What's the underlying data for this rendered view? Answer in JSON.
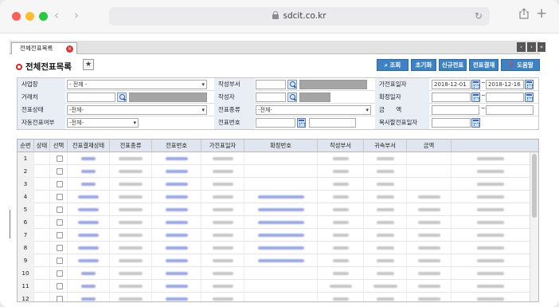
{
  "browser": {
    "url": "sdcit.co.kr"
  },
  "tab": {
    "label": "전체전표목록"
  },
  "page": {
    "title": "전체전표목록"
  },
  "toolbar": {
    "search": "조회",
    "reset": "초기화",
    "new": "신규전표",
    "approve": "전표결재",
    "help": "도움말"
  },
  "form": {
    "row1": {
      "l1": "사업장",
      "v1": "- 전체 -",
      "l2": "작성부서",
      "l3": "가전표일자",
      "date_from": "2018-12-01",
      "date_to": "2018-12-16"
    },
    "row2": {
      "l1": "거래처",
      "l2": "작성자",
      "l3": "확정일자"
    },
    "row3": {
      "l1": "전표상태",
      "v1": "-전체-",
      "l2": "전표종류",
      "v2": "-전체-",
      "l3": "금      액"
    },
    "row4": {
      "l1": "자동전표여부",
      "v1": "-전체-",
      "l2": "전표번호",
      "l3": "복사할전표일자"
    }
  },
  "grid": {
    "headers": [
      "순번",
      "상태",
      "선택",
      "전표결재상태",
      "전표종류",
      "전표번호",
      "가전표일자",
      "확정번호",
      "작성부서",
      "귀속부서",
      "금액"
    ],
    "rows": [
      "1",
      "2",
      "3",
      "4",
      "5",
      "6",
      "7",
      "8",
      "9",
      "10",
      "11",
      "12"
    ]
  }
}
